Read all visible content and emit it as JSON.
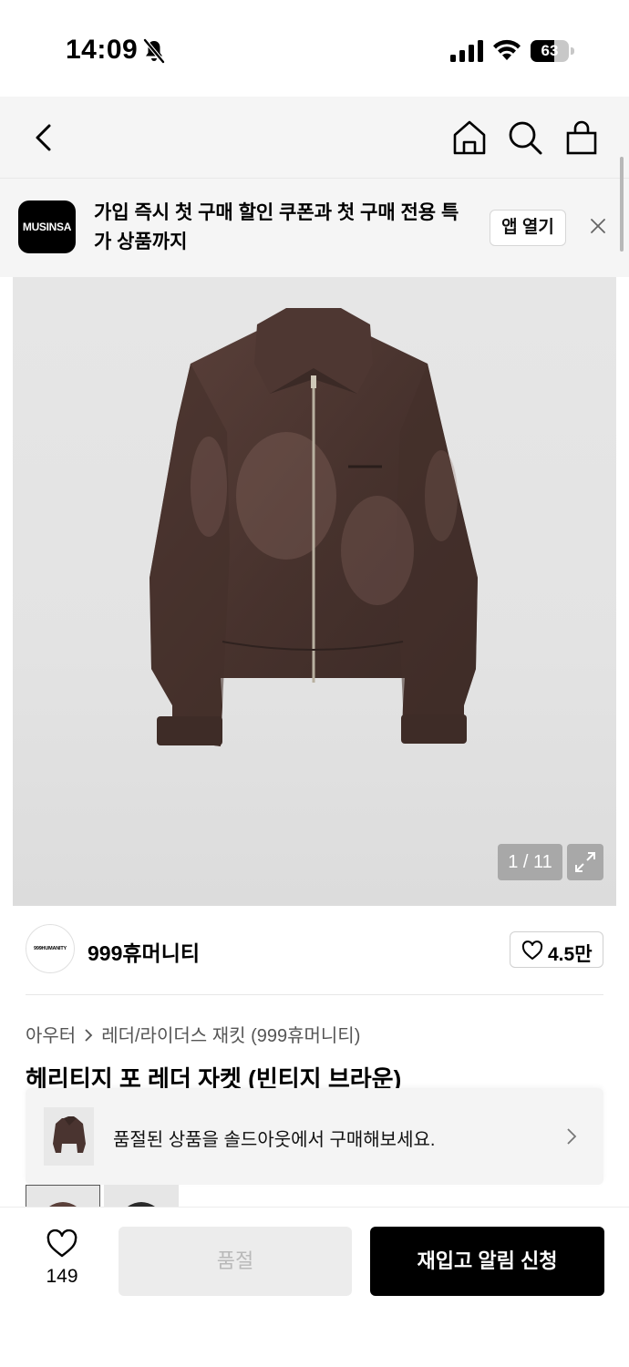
{
  "status_bar": {
    "time": "14:09",
    "battery": "63",
    "battery_level": 0.63,
    "icons": [
      "bell-slash-icon",
      "cellular-signal-icon",
      "wifi-icon",
      "battery-icon"
    ]
  },
  "top_nav": {
    "icons": [
      "back-chevron-icon",
      "home-icon",
      "search-icon",
      "shopping-bag-icon"
    ]
  },
  "app_banner": {
    "logo_text": "MUSINSA",
    "message": "가입 즉시 첫 구매 할인 쿠폰과 첫 구매 전용 특가 상품까지",
    "open_label": "앱 열기",
    "close_icon": "close-icon"
  },
  "gallery": {
    "counter": "1 / 11",
    "current_image": 1,
    "total_images": 11,
    "expand_icon": "expand-icon",
    "background_color": "#e4e4e4",
    "product_color": "#4a3430"
  },
  "brand": {
    "logo_text": "999HUMANITY",
    "name": "999휴머니티",
    "like_count": "4.5만"
  },
  "breadcrumb": {
    "category": "아우터",
    "subcategory": "레더/라이더스 재킷 (999휴머니티)"
  },
  "product": {
    "title": "헤리티지 포 레더 자켓 (빈티지 브라운)"
  },
  "soldout_notice": {
    "text": "품절된 상품을 솔드아웃에서 구매해보세요."
  },
  "bottom_bar": {
    "wish_count": "149",
    "soldout_label": "품절",
    "restock_label": "재입고 알림 신청"
  },
  "colors": {
    "accent": "#000000",
    "banner_bg": "#f5f5f5",
    "disabled_btn": "#ececec",
    "disabled_text": "#b9b9b9"
  }
}
